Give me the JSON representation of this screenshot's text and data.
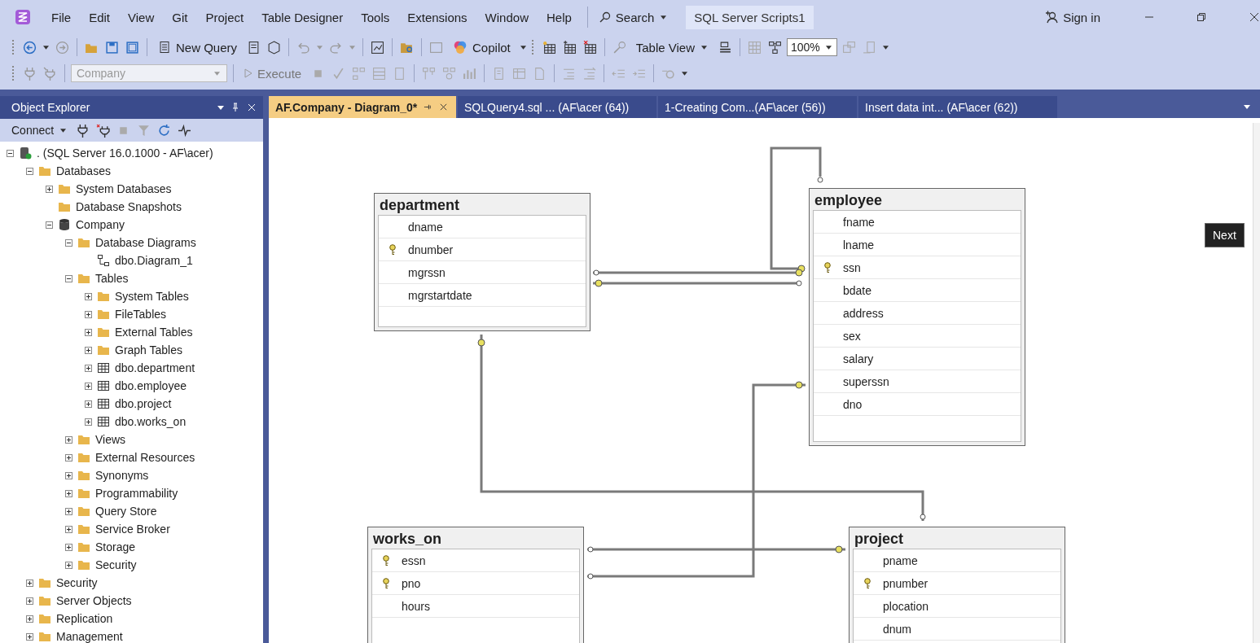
{
  "menu": [
    "File",
    "Edit",
    "View",
    "Git",
    "Project",
    "Table Designer",
    "Tools",
    "Extensions",
    "Window",
    "Help"
  ],
  "search": "Search",
  "window": {
    "title": "SQL Server Scripts1",
    "sign_in": "Sign in"
  },
  "toolbar1": {
    "new_query": "New Query",
    "copilot": "Copilot",
    "table_view": "Table View",
    "zoom": "100%"
  },
  "toolbar2": {
    "database": {
      "value": "Company",
      "disabled": true
    },
    "execute": {
      "label": "Execute",
      "disabled": true
    }
  },
  "object_explorer": {
    "title": "Object Explorer",
    "connect": "Connect",
    "tree": [
      {
        "label": ". (SQL Server 16.0.1000 - AF\\acer)",
        "kind": "server",
        "expanded": true,
        "children": [
          {
            "label": "Databases",
            "kind": "folder",
            "expanded": true,
            "children": [
              {
                "label": "System Databases",
                "kind": "folder",
                "expanded": false
              },
              {
                "label": "Database Snapshots",
                "kind": "folder"
              },
              {
                "label": "Company",
                "kind": "database",
                "expanded": true,
                "children": [
                  {
                    "label": "Database Diagrams",
                    "kind": "folder",
                    "expanded": true,
                    "children": [
                      {
                        "label": "dbo.Diagram_1",
                        "kind": "diagram"
                      }
                    ]
                  },
                  {
                    "label": "Tables",
                    "kind": "folder",
                    "expanded": true,
                    "children": [
                      {
                        "label": "System Tables",
                        "kind": "folder",
                        "expanded": false
                      },
                      {
                        "label": "FileTables",
                        "kind": "folder",
                        "expanded": false
                      },
                      {
                        "label": "External Tables",
                        "kind": "folder",
                        "expanded": false
                      },
                      {
                        "label": "Graph Tables",
                        "kind": "folder",
                        "expanded": false
                      },
                      {
                        "label": "dbo.department",
                        "kind": "table",
                        "expanded": false
                      },
                      {
                        "label": "dbo.employee",
                        "kind": "table",
                        "expanded": false
                      },
                      {
                        "label": "dbo.project",
                        "kind": "table",
                        "expanded": false
                      },
                      {
                        "label": "dbo.works_on",
                        "kind": "table",
                        "expanded": false
                      }
                    ]
                  },
                  {
                    "label": "Views",
                    "kind": "folder",
                    "expanded": false
                  },
                  {
                    "label": "External Resources",
                    "kind": "folder",
                    "expanded": false
                  },
                  {
                    "label": "Synonyms",
                    "kind": "folder",
                    "expanded": false
                  },
                  {
                    "label": "Programmability",
                    "kind": "folder",
                    "expanded": false
                  },
                  {
                    "label": "Query Store",
                    "kind": "folder",
                    "expanded": false
                  },
                  {
                    "label": "Service Broker",
                    "kind": "folder",
                    "expanded": false
                  },
                  {
                    "label": "Storage",
                    "kind": "folder",
                    "expanded": false
                  },
                  {
                    "label": "Security",
                    "kind": "folder",
                    "expanded": false
                  }
                ]
              }
            ]
          },
          {
            "label": "Security",
            "kind": "folder",
            "expanded": false
          },
          {
            "label": "Server Objects",
            "kind": "folder",
            "expanded": false
          },
          {
            "label": "Replication",
            "kind": "folder",
            "expanded": false
          },
          {
            "label": "Management",
            "kind": "folder",
            "expanded": false
          }
        ]
      }
    ]
  },
  "tabs": [
    {
      "label": "AF.Company - Diagram_0*",
      "selected": true
    },
    {
      "label": "SQLQuery4.sql ... (AF\\acer (64))",
      "selected": false
    },
    {
      "label": "1-Creating Com...(AF\\acer (56))",
      "selected": false
    },
    {
      "label": "Insert data int... (AF\\acer (62))",
      "selected": false
    }
  ],
  "diagram": {
    "tables": [
      {
        "name": "department",
        "columns": [
          {
            "name": "dname",
            "primary_key": false
          },
          {
            "name": "dnumber",
            "primary_key": true
          },
          {
            "name": "mgrssn",
            "primary_key": false
          },
          {
            "name": "mgrstartdate",
            "primary_key": false
          }
        ]
      },
      {
        "name": "employee",
        "columns": [
          {
            "name": "fname",
            "primary_key": false
          },
          {
            "name": "lname",
            "primary_key": false
          },
          {
            "name": "ssn",
            "primary_key": true
          },
          {
            "name": "bdate",
            "primary_key": false
          },
          {
            "name": "address",
            "primary_key": false
          },
          {
            "name": "sex",
            "primary_key": false
          },
          {
            "name": "salary",
            "primary_key": false
          },
          {
            "name": "superssn",
            "primary_key": false
          },
          {
            "name": "dno",
            "primary_key": false
          }
        ]
      },
      {
        "name": "works_on",
        "columns": [
          {
            "name": "essn",
            "primary_key": true
          },
          {
            "name": "pno",
            "primary_key": true
          },
          {
            "name": "hours",
            "primary_key": false
          }
        ]
      },
      {
        "name": "project",
        "columns": [
          {
            "name": "pname",
            "primary_key": false
          },
          {
            "name": "pnumber",
            "primary_key": true
          },
          {
            "name": "plocation",
            "primary_key": false
          },
          {
            "name": "dnum",
            "primary_key": false
          }
        ]
      }
    ]
  },
  "tooltip": "Next"
}
